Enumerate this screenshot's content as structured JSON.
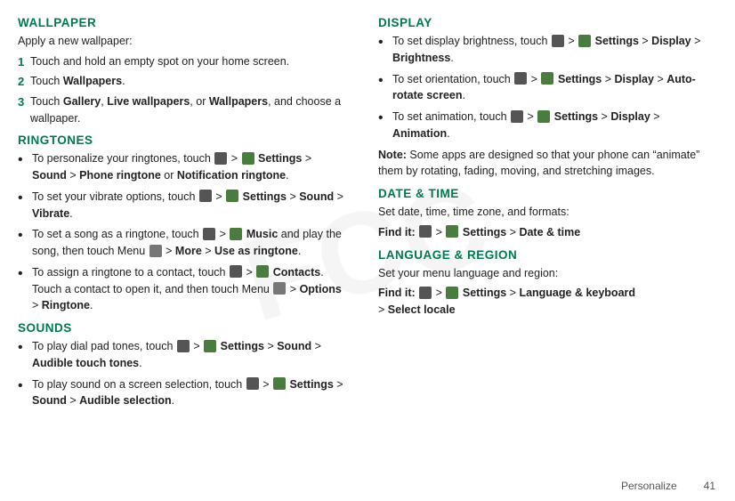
{
  "watermark": "FCC",
  "left": {
    "wallpaper": {
      "title": "WALLPAPER",
      "intro": "Apply a new wallpaper:",
      "steps": [
        {
          "num": "1",
          "text": "Touch and hold an empty spot on your home screen."
        },
        {
          "num": "2",
          "text_plain": "Touch ",
          "text_bold": "Wallpapers",
          "text_end": "."
        },
        {
          "num": "3",
          "text_pre": "Touch ",
          "bold1": "Gallery",
          "sep1": ", ",
          "bold2": "Live wallpapers",
          "sep2": ", or ",
          "bold3": "Wallpapers",
          "end": ", and choose a wallpaper."
        }
      ]
    },
    "ringtones": {
      "title": "RINGTONES",
      "items": [
        {
          "text_pre": "To personalize your ringtones, touch ",
          "icon1": true,
          "sep1": " > ",
          "icon2_green": true,
          "bold1": " Settings",
          "sep2": " > ",
          "bold2": "Sound",
          "sep3": " > ",
          "bold3": "Phone ringtone",
          "text_mid": " or ",
          "bold4": "Notification ringtone",
          "end": "."
        },
        {
          "text_pre": "To set your vibrate options, touch ",
          "icon1": true,
          "sep1": " > ",
          "icon2_green": true,
          "bold1": " Settings",
          "sep2": " > ",
          "bold2": "Sound",
          "sep3": " > ",
          "bold3": "Vibrate",
          "end": "."
        },
        {
          "text_pre": "To set a song as a ringtone, touch ",
          "icon1": true,
          "sep1": " > ",
          "icon2_music": true,
          "bold1": " Music",
          "text_mid": " and play the song, then touch Menu ",
          "icon_grid": true,
          "sep2": " > ",
          "bold2": "More",
          "sep3": " > ",
          "bold3": "Use as ringtone",
          "end": "."
        },
        {
          "text_pre": "To assign a ringtone to a contact, touch ",
          "icon1": true,
          "sep1": " > ",
          "icon_contacts": true,
          "bold1": " Contacts",
          "text_mid": ". Touch a contact to open it, and then touch Menu ",
          "icon_grid": true,
          "sep2": " > ",
          "bold2": "Options",
          "sep3": " > ",
          "bold3": "Ringtone",
          "end": "."
        }
      ]
    },
    "sounds": {
      "title": "SOUNDS",
      "items": [
        {
          "text_pre": "To play dial pad tones, touch ",
          "icon1": true,
          "sep1": " > ",
          "icon2_green": true,
          "bold1": " Settings",
          "sep2": " > ",
          "bold2": "Sound",
          "sep3": " > ",
          "bold3": "Audible touch tones",
          "end": "."
        },
        {
          "text_pre": "To play sound on a screen selection, touch ",
          "icon1": true,
          "sep1": " > ",
          "icon2_green": true,
          "bold1": " Settings",
          "sep2": " > ",
          "bold2": "Sound",
          "sep3": " > ",
          "bold3": "Audible selection",
          "end": "."
        }
      ]
    }
  },
  "right": {
    "display": {
      "title": "DISPLAY",
      "items": [
        {
          "text_pre": "To set display brightness, touch ",
          "icon1": true,
          "sep1": " > ",
          "icon2_green": true,
          "bold1": " Settings",
          "sep2": " > ",
          "bold2": "Display",
          "sep3": " > ",
          "bold3": "Brightness",
          "end": "."
        },
        {
          "text_pre": "To set orientation, touch ",
          "icon1": true,
          "sep1": " > ",
          "icon2_green": true,
          "bold1": " Settings",
          "sep2": " > ",
          "bold2": "Display",
          "sep3": " > ",
          "bold3": "Auto-rotate screen",
          "end": "."
        },
        {
          "text_pre": "To set animation, touch ",
          "icon1": true,
          "sep1": " > ",
          "icon2_green": true,
          "bold1": " Settings",
          "sep2": " > ",
          "bold2": "Display",
          "sep3": " > ",
          "bold3": "Animation",
          "end": "."
        }
      ],
      "note": "Note:",
      "note_text": " Some apps are designed so that your phone can “animate” them by rotating, fading, moving, and stretching images."
    },
    "datetime": {
      "title": "DATE & TIME",
      "intro": "Set date, time, time zone, and formats:",
      "find_label": "Find it:",
      "find_text_pre": " ",
      "find_icon1": true,
      "find_sep1": " > ",
      "find_icon2_green": true,
      "find_bold1": " Settings",
      "find_sep2": " > ",
      "find_bold2": "Date & time"
    },
    "language": {
      "title": "LANGUAGE & REGION",
      "intro": "Set your menu language and region:",
      "find_label": "Find it:",
      "find_text_pre": " ",
      "find_icon1": true,
      "find_sep1": " > ",
      "find_icon2_green": true,
      "find_bold1": " Settings",
      "find_sep2": " > ",
      "find_bold2": "Language & keyboard",
      "find_sep3": " > ",
      "find_bold3": "Select locale"
    }
  },
  "footer": {
    "label": "Personalize",
    "page": "41"
  }
}
